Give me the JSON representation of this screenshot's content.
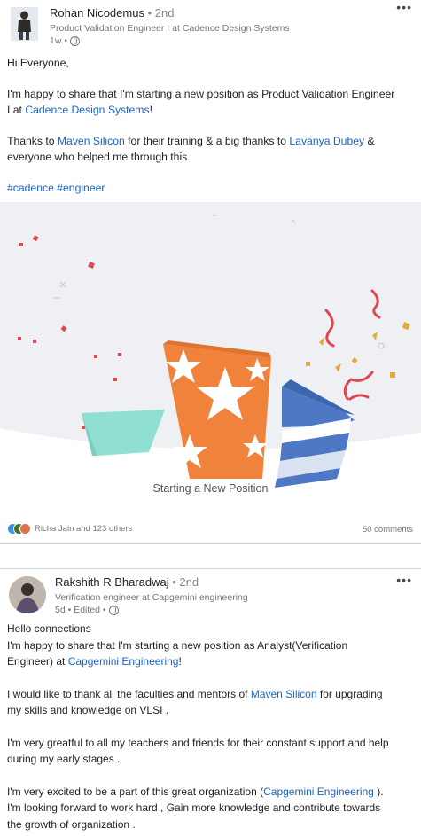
{
  "post1": {
    "author": "Rohan Nicodemus",
    "degree": "• 2nd",
    "headline": "Product Validation Engineer I at Cadence Design Systems",
    "time": "1w •",
    "more": "•••",
    "greeting": "Hi Everyone,",
    "line1": "I'm happy to share that I'm starting a new position as Product Validation Engineer",
    "line2_prefix": "I at ",
    "line2_link": "Cadence Design Systems",
    "line2_suffix": "!",
    "thanks_prefix": "Thanks to ",
    "thanks_link1": "Maven Silicon",
    "thanks_mid": " for their training & a big thanks to ",
    "thanks_link2": "Lavanya Dubey",
    "thanks_suffix": " &",
    "thanks_line2": "everyone who helped me through this.",
    "hashtags": "#cadence #engineer",
    "banner_caption": "Starting a New Position",
    "reactions_text": "Richa Jain and 123 others",
    "comments": "50 comments",
    "reaction_colors": [
      "#378fe9",
      "#44712e",
      "#df704d"
    ]
  },
  "post2": {
    "author": "Rakshith R Bharadwaj",
    "degree": "• 2nd",
    "headline": "Verification engineer at Capgemini engineering",
    "time": "5d • Edited •",
    "more": "•••",
    "greeting": "Hello connections",
    "line1": "I'm happy to share that I'm starting a new position as Analyst(Verification",
    "line2_prefix": "Engineer) at ",
    "line2_link": "Capgemini Engineering",
    "line2_suffix": "!",
    "thank_prefix": "I would like to thank all the faculties and mentors of ",
    "thank_link": "Maven Silicon",
    "thank_suffix": " for upgrading",
    "thank_line2": "my skills and knowledge on VLSI .",
    "great1": "I'm very greatful to all my teachers and friends for their constant support and help",
    "great2": "during my early stages .",
    "excited_prefix": "I'm very excited to be a part of this great organization (",
    "excited_link": "Capgemini Engineering",
    "excited_suffix": " ).",
    "forward1": "I'm looking forward to work hard , Gain more knowledge and contribute towards",
    "forward2": "the growth of organization ."
  },
  "colors": {
    "link": "#1a64c4",
    "orange": "#f0823c",
    "teal": "#8fe0d3",
    "blue": "#4f78c4",
    "banner_bg": "#eef0f4",
    "confetti_red": "#e04554",
    "confetti_gold": "#e8a93c"
  }
}
